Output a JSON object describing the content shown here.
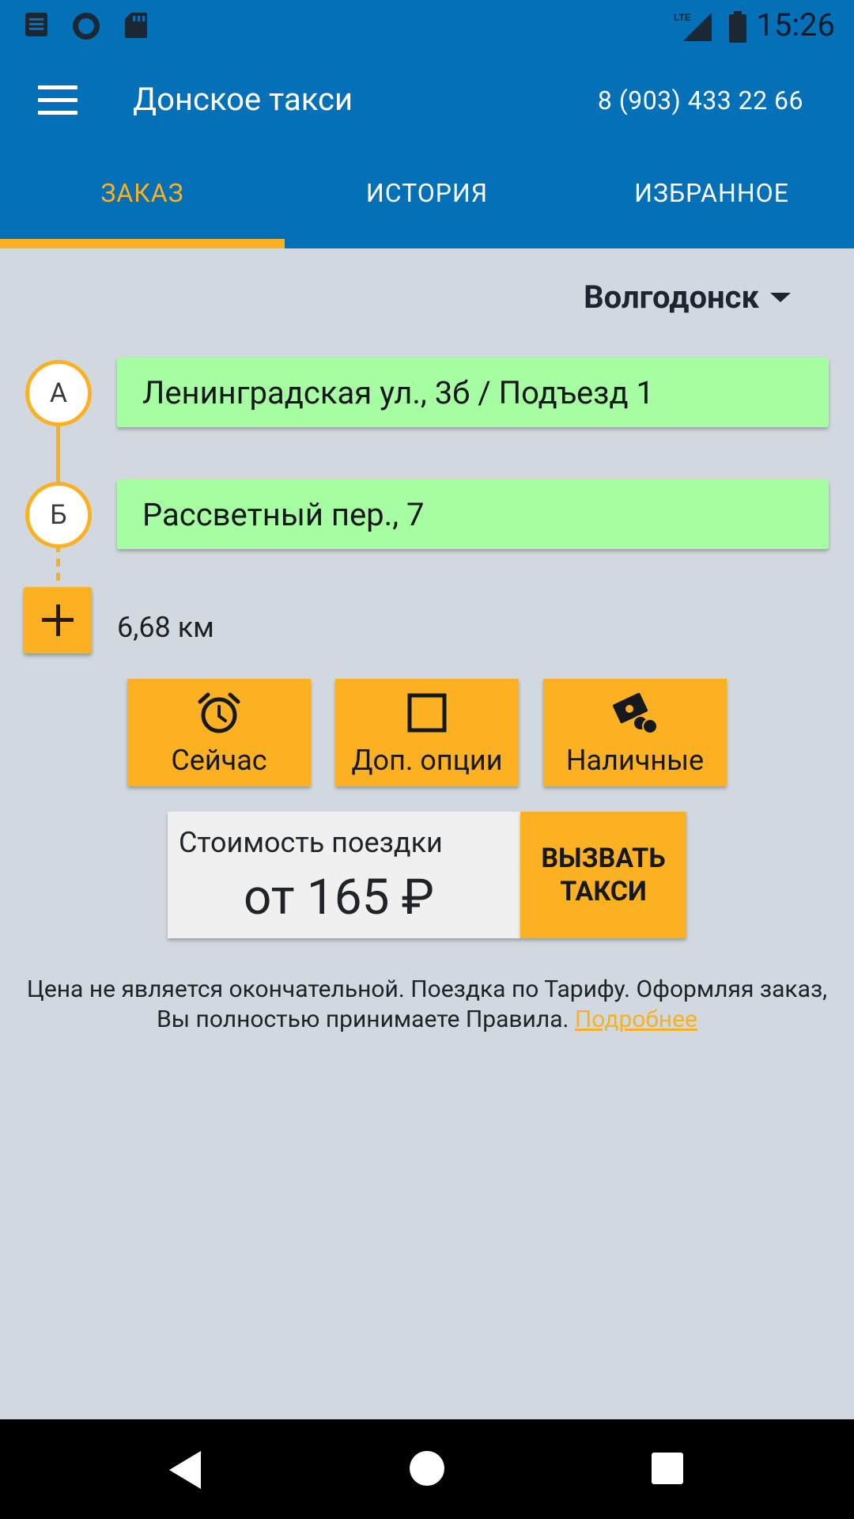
{
  "status_bar": {
    "time": "15:26",
    "network": "LTE",
    "icons": [
      "notification-icon",
      "circle-app-icon",
      "sd-card-icon",
      "signal-icon",
      "battery-icon"
    ]
  },
  "toolbar": {
    "title": "Донское такси",
    "phone": "8 (903) 433 22 66"
  },
  "tabs": [
    {
      "label": "ЗАКАЗ",
      "active": true
    },
    {
      "label": "ИСТОРИЯ",
      "active": false
    },
    {
      "label": "ИЗБРАННОЕ",
      "active": false
    }
  ],
  "city": "Волгодонск",
  "route": {
    "points": [
      {
        "marker": "А",
        "address": "Ленинградская ул., 3б / Подъезд 1"
      },
      {
        "marker": "Б",
        "address": "Рассветный пер., 7"
      }
    ],
    "distance": "6,68 км"
  },
  "options": [
    {
      "label": "Сейчас",
      "icon": "alarm-clock-icon"
    },
    {
      "label": "Доп. опции",
      "icon": "checkbox-icon"
    },
    {
      "label": "Наличные",
      "icon": "cash-icon"
    }
  ],
  "price": {
    "label": "Стоимость поездки",
    "value": "от 165 ₽"
  },
  "call_button": {
    "line1": "ВЫЗВАТЬ",
    "line2": "ТАКСИ"
  },
  "disclaimer": {
    "text": "Цена не является окончательной. Поездка по Тарифу. Оформляя заказ, Вы полностью принимаете Правила.",
    "link": "Подробнее"
  },
  "colors": {
    "primary": "#0470b8",
    "accent": "#fbb121",
    "address_bg": "#a7fea2",
    "background": "#d2d8df"
  }
}
